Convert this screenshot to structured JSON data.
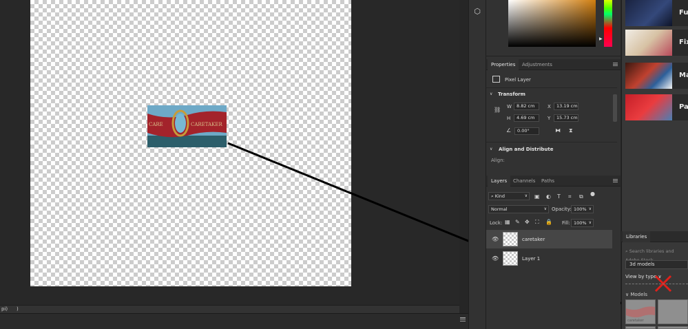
{
  "status_bar": {
    "zoom_text": "pi)",
    "arrow": ")"
  },
  "canvas": {
    "image_text_left": "CARE",
    "image_text_right": "CARETAKER"
  },
  "properties_panel": {
    "tabs": [
      "Properties",
      "Adjustments"
    ],
    "layer_type": "Pixel Layer",
    "transform": {
      "heading": "Transform",
      "w_label": "W",
      "w_value": "8.82 cm",
      "h_label": "H",
      "h_value": "4.69 cm",
      "x_label": "X",
      "x_value": "13.19 cm",
      "y_label": "Y",
      "y_value": "15.73 cm",
      "angle_value": "0.00°"
    },
    "align": {
      "heading": "Align and Distribute",
      "label": "Align:"
    }
  },
  "layers_panel": {
    "tabs": [
      "Layers",
      "Channels",
      "Paths"
    ],
    "kind_filter": "Kind",
    "blend_mode": "Normal",
    "opacity_label": "Opacity:",
    "opacity_value": "100%",
    "lock_label": "Lock:",
    "fill_label": "Fill:",
    "fill_value": "100%",
    "layers": [
      {
        "name": "caretaker",
        "selected": true
      },
      {
        "name": "Layer 1",
        "selected": false
      }
    ]
  },
  "libraries_panel": {
    "thumb_labels": [
      "Fu",
      "Fix",
      "Ma",
      "Pa"
    ],
    "tab": "Libraries",
    "search_placeholder": "Search libraries and Adobe Stock",
    "selected_library": "3d models",
    "view_by": "View by type",
    "models_heading": "Models",
    "model_caption": "caretaker"
  },
  "colors": {
    "accent_annotation": "#e0201a",
    "annotation_line": "#000000"
  },
  "icons": {
    "cube": "3d-cube-icon",
    "eye": "eye-icon",
    "link": "link-icon"
  }
}
